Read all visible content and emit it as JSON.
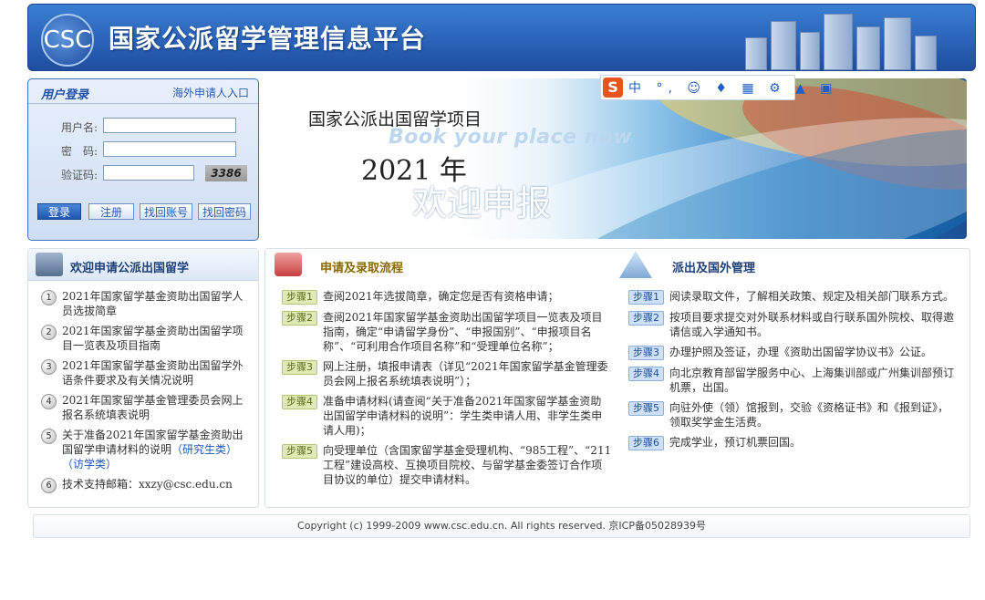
{
  "header": {
    "site_title": "国家公派留学管理信息平台",
    "logo_text": "CSC"
  },
  "login": {
    "title": "用户登录",
    "overseas_link": "海外申请人入口",
    "username_label": "用户名:",
    "password_label": "密　码:",
    "captcha_label": "验证码:",
    "username_value": "",
    "password_value": "",
    "captcha_value": "",
    "captcha_code": "3386",
    "buttons": {
      "login": "登录",
      "register": "注册",
      "find_account": "找回账号",
      "find_password": "找回密码"
    }
  },
  "banner": {
    "title": "国家公派出国留学项目",
    "subtitle": "Book your place now",
    "year": "2021 年",
    "welcome": "欢迎申报"
  },
  "ime_toolbar": {
    "logo": "S",
    "icons": "中 °, ☺ ♦ ▦ ⚙ ▲ ▣"
  },
  "apply_section": {
    "title": "欢迎申请公派出国留学",
    "items": [
      {
        "num": "1",
        "text": "2021年国家留学基金资助出国留学人员选拔简章"
      },
      {
        "num": "2",
        "text": "2021年国家留学基金资助出国留学项目一览表及项目指南"
      },
      {
        "num": "3",
        "text": "2021年国家留学基金资助出国留学外语条件要求及有关情况说明"
      },
      {
        "num": "4",
        "text": "2021年国家留学基金管理委员会网上报名系统填表说明"
      },
      {
        "num": "5",
        "text": "关于准备2021年国家留学基金资助出国留学申请材料的说明",
        "link1": "（研究生类）",
        "link2": "（访学类）"
      },
      {
        "num": "6",
        "text": "技术支持邮箱：xxzy@csc.edu.cn"
      }
    ]
  },
  "flow_section": {
    "title": "申请及录取流程",
    "steps": [
      {
        "badge": "步骤1",
        "text": "查阅2021年选拔简章，确定您是否有资格申请；"
      },
      {
        "badge": "步骤2",
        "text": "查阅2021年国家留学基金资助出国留学项目一览表及项目指南，确定“申请留学身份”、“申报国别”、“申报项目名称”、“可利用合作项目名称”和“受理单位名称”；"
      },
      {
        "badge": "步骤3",
        "text": "网上注册，填报申请表（详见“2021年国家留学基金管理委员会网上报名系统填表说明”）；"
      },
      {
        "badge": "步骤4",
        "text": "准备申请材料(请查阅“关于准备2021年国家留学基金资助出国留学申请材料的说明”：学生类申请人用、非学生类申请人用)；"
      },
      {
        "badge": "步骤5",
        "text": "向受理单位（含国家留学基金受理机构、“985工程”、“211工程”建设高校、互换项目院校、与留学基金委签订合作项目协议的单位）提交申请材料。"
      }
    ]
  },
  "dispatch_section": {
    "title": "派出及国外管理",
    "steps": [
      {
        "badge": "步骤1",
        "text": "阅读录取文件，了解相关政策、规定及相关部门联系方式。"
      },
      {
        "badge": "步骤2",
        "text": "按项目要求提交对外联系材料或自行联系国外院校、取得邀请信或入学通知书。"
      },
      {
        "badge": "步骤3",
        "text": "办理护照及签证，办理《资助出国留学协议书》公证。"
      },
      {
        "badge": "步骤4",
        "text": "向北京教育部留学服务中心、上海集训部或广州集训部预订机票，出国。"
      },
      {
        "badge": "步骤5",
        "text": "向驻外使（领）馆报到，交验《资格证书》和《报到证》，领取奖学金生活费。"
      },
      {
        "badge": "步骤6",
        "text": "完成学业，预订机票回国。"
      }
    ]
  },
  "footer": {
    "copyright": "Copyright (c) 1999-2009 www.csc.edu.cn.  All rights reserved.  京ICP备05028939号"
  }
}
